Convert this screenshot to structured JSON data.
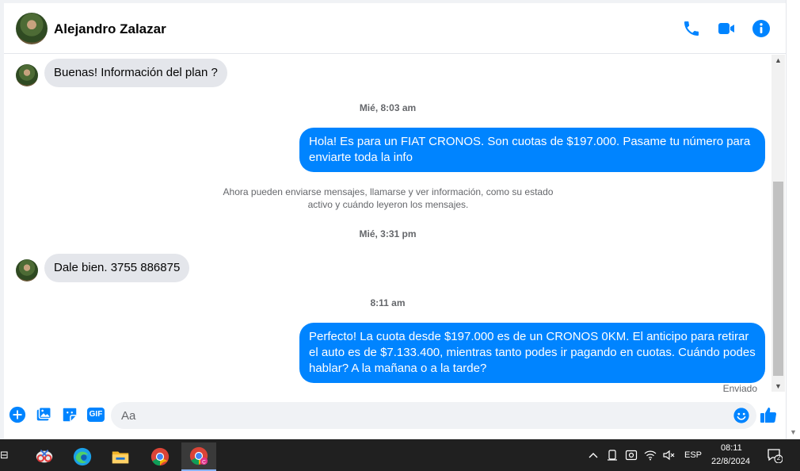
{
  "header": {
    "contact_name": "Alejandro Zalazar",
    "icons": [
      "phone-icon",
      "video-icon",
      "info-icon"
    ],
    "accent": "#0084ff"
  },
  "messages": [
    {
      "type": "received",
      "text": "Buenas! Información del plan ?"
    },
    {
      "type": "timestamp",
      "text": "Mié, 8:03 am"
    },
    {
      "type": "sent",
      "text": "Hola! Es para un FIAT CRONOS. Son cuotas de $197.000. Pasame tu número para enviarte toda la info"
    },
    {
      "type": "system",
      "text": "Ahora pueden enviarse mensajes, llamarse y ver información, como su estado activo y cuándo leyeron los mensajes."
    },
    {
      "type": "timestamp",
      "text": "Mié, 3:31 pm"
    },
    {
      "type": "received",
      "text": "Dale bien. 3755 886875"
    },
    {
      "type": "timestamp",
      "text": "8:11 am"
    },
    {
      "type": "sent",
      "text": "Perfecto! La cuota desde $197.000 es de un CRONOS 0KM. El anticipo para retirar el auto es de $7.133.400, mientras tanto podes ir pagando en cuotas. Cuándo podes hablar? A la mañana o a la tarde?"
    }
  ],
  "status": {
    "sent_label": "Enviado"
  },
  "composer": {
    "placeholder": "Aa",
    "gif_label": "GIF",
    "icons": [
      "plus-icon",
      "image-icon",
      "sticker-icon",
      "gif-icon",
      "emoji-icon",
      "like-icon"
    ]
  },
  "taskbar": {
    "apps": [
      "snipping-tool-icon",
      "edge-icon",
      "file-explorer-icon",
      "chrome-icon",
      "chrome-profile-icon"
    ],
    "tray": {
      "language": "ESP",
      "time": "08:11",
      "date": "22/8/2024",
      "notifications": "2"
    },
    "background": "#202020"
  }
}
